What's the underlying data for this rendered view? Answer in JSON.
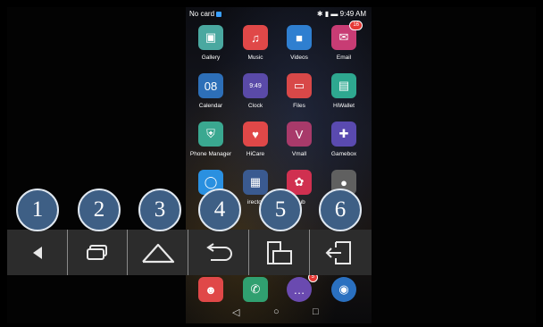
{
  "status_bar": {
    "carrier": "No card",
    "time": "9:49 AM"
  },
  "apps": [
    {
      "label": "Gallery",
      "color": "#4aa8a0",
      "glyph": "▣"
    },
    {
      "label": "Music",
      "color": "#e04848",
      "glyph": "♫"
    },
    {
      "label": "Videos",
      "color": "#2f7fd0",
      "glyph": "■"
    },
    {
      "label": "Email",
      "color": "#c83c74",
      "glyph": "✉",
      "badge": "16"
    },
    {
      "label": "Calendar",
      "color": "#2d6fb8",
      "glyph": "08"
    },
    {
      "label": "Clock",
      "color": "#5a4aa8",
      "glyph": "9:49"
    },
    {
      "label": "Files",
      "color": "#d84848",
      "glyph": "▭"
    },
    {
      "label": "HiWallet",
      "color": "#2ea890",
      "glyph": "▤"
    },
    {
      "label": "Phone Manager",
      "color": "#3aa890",
      "glyph": "⛨"
    },
    {
      "label": "HiCare",
      "color": "#e04848",
      "glyph": "♥"
    },
    {
      "label": "Vmall",
      "color": "#a83a6a",
      "glyph": "V"
    },
    {
      "label": "Gamebox",
      "color": "#5a4ab0",
      "glyph": "✚"
    },
    {
      "label": "",
      "color": "#2a90e0",
      "glyph": "◯"
    },
    {
      "label": "irector",
      "color": "#3a5a90",
      "glyph": "▦"
    },
    {
      "label": "Club",
      "color": "#d03050",
      "glyph": "✿"
    },
    {
      "label": "",
      "color": "#606060",
      "glyph": "●"
    }
  ],
  "dock": [
    {
      "color": "#e04848",
      "glyph": "☻"
    },
    {
      "color": "#30a070",
      "glyph": "✆"
    },
    {
      "color": "#6a4ab0",
      "glyph": "…",
      "badge": "5"
    },
    {
      "color": "#2a70c0",
      "glyph": "◉"
    }
  ],
  "toolbar": {
    "numbers": [
      "1",
      "2",
      "3",
      "4",
      "5",
      "6"
    ],
    "buttons": [
      "back-arrow-icon",
      "recent-apps-icon",
      "home-icon",
      "undo-return-icon",
      "split-window-icon",
      "exit-icon"
    ]
  }
}
